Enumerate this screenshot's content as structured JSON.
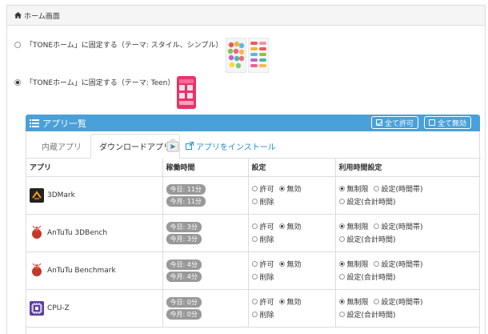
{
  "header": {
    "title": "ホーム画面",
    "icon": "home-icon"
  },
  "home_options": [
    {
      "label": "「TONEホーム」に固定する（テーマ: スタイル、シンプル）",
      "selected": false
    },
    {
      "label": "「TONEホーム」に固定する（テーマ: Teen）",
      "selected": true
    }
  ],
  "app_panel": {
    "title": "アプリ一覧",
    "allow_all_label": "全て許可",
    "disable_all_label": "全て無効",
    "tabs": [
      {
        "label": "内蔵アプリ",
        "active": false
      },
      {
        "label": "ダウンロードアプリ",
        "active": true
      }
    ],
    "install_label": "アプリをインストール",
    "columns": {
      "app": "アプリ",
      "runtime": "稼働時間",
      "setting": "設定",
      "usage": "利用時間設定"
    },
    "setting_labels": {
      "allow": "許可",
      "disable": "無効",
      "delete": "削除"
    },
    "usage_labels": {
      "unlimited": "無制限",
      "period": "設定(時間帯)",
      "total": "設定(合計時間)"
    },
    "apps": [
      {
        "name": "3DMark",
        "today": "今日: 11分",
        "month": "今月: 11分",
        "icon": "3dmark-icon"
      },
      {
        "name": "AnTuTu 3DBench",
        "today": "今日: 3分",
        "month": "今月: 3分",
        "icon": "antutu-icon"
      },
      {
        "name": "AnTuTu Benchmark",
        "today": "今日: 4分",
        "month": "今月: 4分",
        "icon": "antutu-icon"
      },
      {
        "name": "CPU-Z",
        "today": "今日: 0分",
        "month": "今月: 0分",
        "icon": "cpuz-icon"
      }
    ]
  },
  "colors": {
    "accent": "#4aa0d8",
    "link": "#2a8fd0",
    "badge": "#999999",
    "border": "#dddddd"
  }
}
